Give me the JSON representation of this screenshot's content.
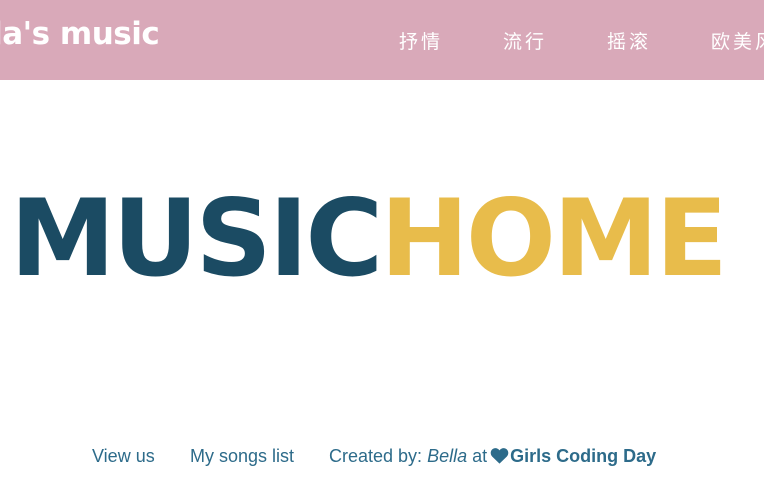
{
  "header": {
    "brand": "lla's music",
    "nav": [
      "抒情",
      "流行",
      "摇滚",
      "欧美风"
    ]
  },
  "hero": {
    "part_a": "MUSIC",
    "part_b": "HOME"
  },
  "footer": {
    "view_us": "View us",
    "songs_list": "My songs list",
    "created_by": "Created by:",
    "author": "Bella",
    "at": "at",
    "heart_icon": "heart-icon",
    "event": "Girls Coding Day"
  },
  "colors": {
    "navbar": "#d9a9b9",
    "hero_dark": "#1b4b63",
    "hero_accent": "#e8bc4b",
    "footer_text": "#2d6b8a"
  }
}
